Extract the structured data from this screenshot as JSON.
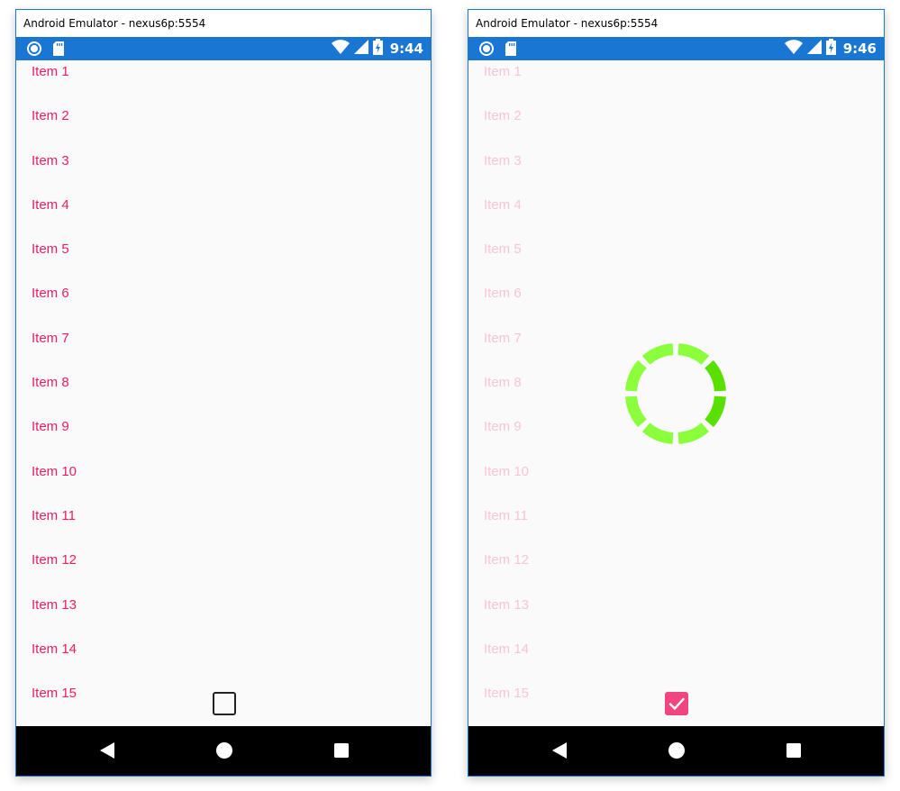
{
  "windows": [
    {
      "title": "Android Emulator - nexus6p:5554",
      "status_bar": {
        "time": "9:44",
        "left_icons": [
          "record-icon",
          "sd-card-icon"
        ],
        "right_icons": [
          "wifi-icon",
          "signal-icon",
          "battery-charging-icon"
        ]
      },
      "list_items": [
        "Item 1",
        "Item 2",
        "Item 3",
        "Item 4",
        "Item 5",
        "Item 6",
        "Item 7",
        "Item 8",
        "Item 9",
        "Item 10",
        "Item 11",
        "Item 12",
        "Item 13",
        "Item 14",
        "Item 15"
      ],
      "checkbox": {
        "checked": false
      },
      "loading": false,
      "nav_buttons": [
        "back-icon",
        "home-icon",
        "recents-icon"
      ]
    },
    {
      "title": "Android Emulator - nexus6p:5554",
      "status_bar": {
        "time": "9:46",
        "left_icons": [
          "record-icon",
          "sd-card-icon"
        ],
        "right_icons": [
          "wifi-icon",
          "signal-icon",
          "battery-charging-icon"
        ]
      },
      "list_items": [
        "Item 1",
        "Item 2",
        "Item 3",
        "Item 4",
        "Item 5",
        "Item 6",
        "Item 7",
        "Item 8",
        "Item 9",
        "Item 10",
        "Item 11",
        "Item 12",
        "Item 13",
        "Item 14",
        "Item 15"
      ],
      "checkbox": {
        "checked": true
      },
      "loading": true,
      "nav_buttons": [
        "back-icon",
        "home-icon",
        "recents-icon"
      ]
    }
  ],
  "colors": {
    "status_bar": "#1976d2",
    "accent": "#e91e63",
    "accent_faded": "#f8c5d6",
    "checkbox_checked": "#f0457e",
    "spinner_light": "#8cff3c",
    "spinner_dark": "#5ae000",
    "nav_bar": "#000000"
  }
}
